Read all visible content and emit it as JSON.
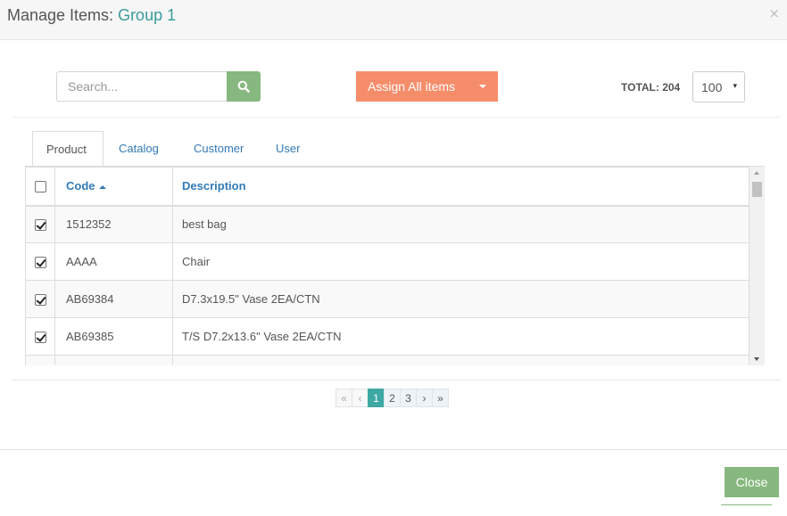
{
  "header": {
    "title_prefix": "Manage Items: ",
    "group_name": "Group 1",
    "close_glyph": "×"
  },
  "toolbar": {
    "search_placeholder": "Search...",
    "search_icon": "search-icon",
    "assign_label": "Assign All items",
    "total_label": "TOTAL: 204",
    "per_page_value": "100",
    "per_page_arrow": "▾"
  },
  "tabs": [
    {
      "label": "Product",
      "active": true
    },
    {
      "label": "Catalog",
      "active": false
    },
    {
      "label": "Customer",
      "active": false
    },
    {
      "label": "User",
      "active": false
    }
  ],
  "table": {
    "columns": [
      "Code",
      "Description"
    ],
    "sort_column": "Code",
    "sort_direction": "ascending",
    "rows": [
      {
        "checked": true,
        "code": "1512352",
        "description": "best bag"
      },
      {
        "checked": true,
        "code": "AAAA",
        "description": "Chair"
      },
      {
        "checked": true,
        "code": "AB69384",
        "description": "D7.3x19.5\" Vase 2EA/CTN"
      },
      {
        "checked": true,
        "code": "AB69385",
        "description": "T/S D7.2x13.6\" Vase 2EA/CTN"
      },
      {
        "checked": false,
        "code": "",
        "description": ""
      }
    ]
  },
  "pagination": {
    "first": "«",
    "prev": "‹",
    "pages": [
      "1",
      "2",
      "3"
    ],
    "current_page": "1",
    "next": "›",
    "last": "»"
  },
  "footer": {
    "close_label": "Close"
  },
  "colors": {
    "accent_green": "#87b87f",
    "assign_orange": "#f68d6a",
    "link_blue": "#337ab7",
    "page_active": "#3ea9a4",
    "group_teal": "#3a9b9b"
  }
}
